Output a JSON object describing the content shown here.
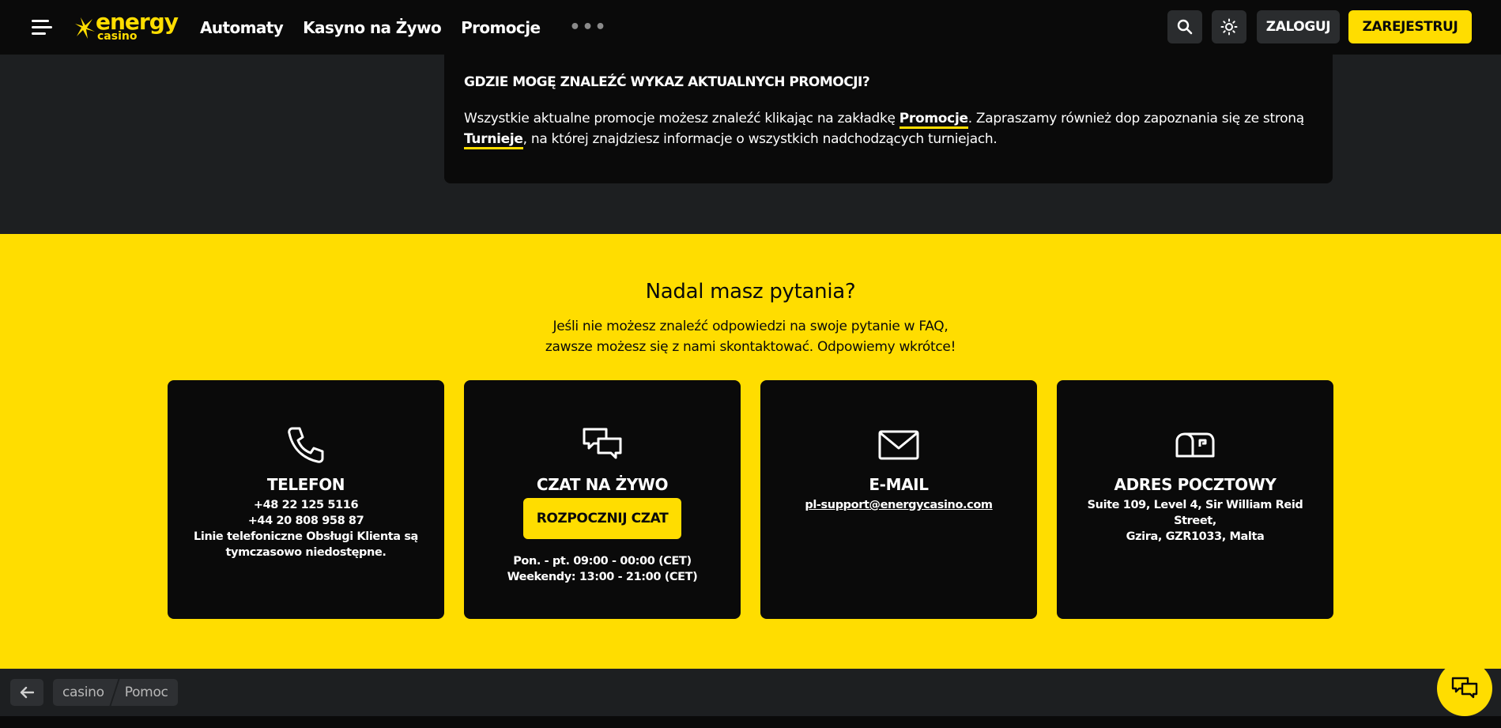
{
  "header": {
    "logo": {
      "word": "energy",
      "sub": "casino"
    },
    "nav": [
      {
        "label": "Automaty"
      },
      {
        "label": "Kasyno na Żywo"
      },
      {
        "label": "Promocje"
      }
    ],
    "more_label": "•••",
    "login_label": "ZALOGUJ",
    "register_label": "ZAREJESTRUJ",
    "icons": {
      "menu": "hamburger-icon",
      "search": "search-icon",
      "theme": "sun-icon"
    }
  },
  "faq": {
    "question": "GDZIE MOGĘ ZNALEŹĆ WYKAZ AKTUALNYCH PROMOCJI?",
    "answer_part1": "Wszystkie aktualne promocje możesz znaleźć klikając na zakładkę ",
    "link1": "Promocje",
    "answer_part2": ". Zapraszamy również dop zapoznania się ze stroną ",
    "link2": "Turnieje",
    "answer_part3": ", na której znajdziesz informacje o wszystkich nadchodzących turniejach."
  },
  "contact": {
    "title": "Nadal masz pytania?",
    "subtitle_line1": "Jeśli nie możesz znaleźć odpowiedzi na swoje pytanie w FAQ,",
    "subtitle_line2": "zawsze możesz się z nami skontaktować. Odpowiemy wkrótce!",
    "cards": {
      "phone": {
        "title": "TELEFON",
        "line1": "+48 22 125 5116",
        "line2": "+44 20 808 958 87",
        "line3": "Linie telefoniczne Obsługi Klienta są tymczasowo niedostępne.",
        "icon": "phone-icon"
      },
      "chat": {
        "title": "CZAT NA ŻYWO",
        "button": "ROZPOCZNIJ CZAT",
        "hours1": "Pon. - pt. 09:00 - 00:00 (CET)",
        "hours2": "Weekendy: 13:00 - 21:00 (CET)",
        "icon": "chat-bubbles-icon"
      },
      "email": {
        "title": "E-MAIL",
        "address": "pl-support@energycasino.com",
        "icon": "envelope-icon"
      },
      "post": {
        "title": "ADRES POCZTOWY",
        "line1": "Suite 109, Level 4, Sir William Reid Street,",
        "line2": "Gzira, GZR1033, Malta",
        "icon": "mailbox-icon"
      }
    }
  },
  "footer": {
    "breadcrumbs": [
      {
        "label": "casino"
      },
      {
        "label": "Pomoc"
      }
    ],
    "icons": {
      "back": "arrow-left-icon",
      "fab": "chat-icon"
    }
  },
  "colors": {
    "accent": "#ffdd00",
    "dark": "#0a0a0a",
    "panel": "#1d1f21",
    "button": "#2a2c2e"
  }
}
